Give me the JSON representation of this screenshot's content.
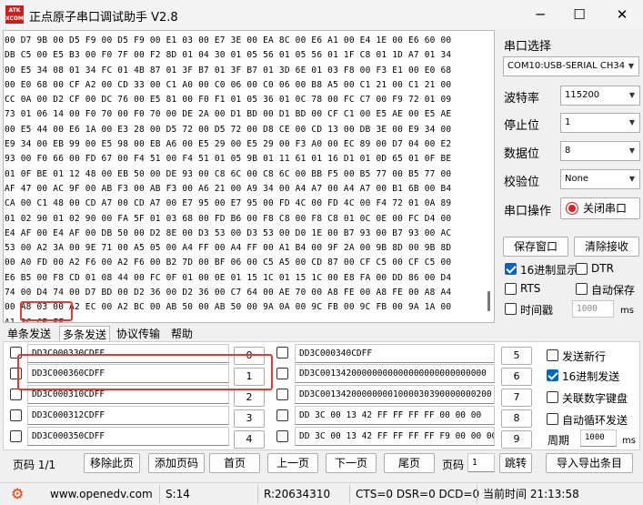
{
  "window": {
    "logo_top": "ATK",
    "logo_bottom": "XCOM",
    "title": "正点原子串口调试助手 V2.8",
    "minimize": "─",
    "maximize": "☐",
    "close": "✕"
  },
  "receive": {
    "lines": [
      "00 D7 9B 00 D5 F9 00 D5 F9 00 E1 03 00 E7 3E 00 EA 8C 00 E6 A1 00 E4 1E 00 E6 60 00",
      "DB C5 00 E5 B3 00 F0 7F 00 F2 8D 01 04 30 01 05 56 01 05 56 01 1F C8 01 1D A7 01 34",
      "00 E5 34 08 01 34 FC 01 4B 87 01 3F B7 01 3F B7 01 3D 6E 01 03 F8 00 F3 E1 00 E0 68",
      "00 E0 68 00 CF A2 00 CD 33 00 C1 A0 00 C0 06 00 C0 06 00 B8 A5 00 C1 21 00 C1 21 00",
      "CC 0A 00 D2 CF 00 DC 76 00 E5 81 00 F0 F1 01 05 36 01 0C 78 00 FC C7 00 F9 72 01 09",
      "73 01 06 14 00 F0 70 00 F0 70 00 DE 2A 00 D1 BD 00 D1 BD 00 CF C1 00 E5 AE 00 E5 AE",
      "00 E5 44 00 E6 1A 00 E3 28 00 D5 72 00 D5 72 00 D8 CE 00 CD 13 00 DB 3E 00 E9 34 00",
      "E9 34 00 EB 99 00 E5 98 00 EB A6 00 E5 29 00 E5 29 00 F3 A0 00 EC 89 00 D7 04 00 E2",
      "93 00 F0 66 00 FD 67 00 F4 51 00 F4 51 01 05 9B 01 11 61 01 16 D1 01 0D 65 01 0F BE",
      "01 0F BE 01 12 48 00 EB 50 00 DE 93 00 C8 6C 00 C8 6C 00 BB F5 00 B5 77 00 B5 77 00",
      "AF 47 00 AC 9F 00 AB F3 00 AB F3 00 A6 21 00 A9 34 00 A4 A7 00 A4 A7 00 B1 6B 00 B4",
      "CA 00 C1 48 00 CD A7 00 CD A7 00 E7 95 00 E7 95 00 FD 4C 00 FD 4C 00 F4 72 01 0A 89",
      "01 02 90 01 02 90 00 FA 5F 01 03 68 00 FD B6 00 F8 C8 00 F8 C8 01 0C 0E 00 FC D4 00",
      "E4 AF 00 E4 AF 00 DB 50 00 D2 8E 00 D3 53 00 D3 53 00 D0 1E 00 B7 93 00 B7 93 00 AC",
      "53 00 A2 3A 00 9E 71 00 A5 05 00 A4 FF 00 A4 FF 00 A1 B4 00 9F 2A 00 9B 8D 00 9B 8D",
      "00 A0 FD 00 A2 F6 00 A2 F6 00 B2 7D 00 BF 06 00 C5 A5 00 CD 87 00 CF C5 00 CF C5 00",
      "E6 B5 00 F8 CD 01 08 44 00 FC 0F 01 00 0E 01 15 1C 01 15 1C 00 E8 FA 00 DD 86 00 D4",
      "74 00 D4 74 00 D7 BD 00 D2 36 00 D2 36 00 C7 64 00 AE 70 00 A8 FE 00 A8 FE 00 A8 A4",
      "00 A8 03 00 A2 EC 00 A2 BC 00 AB 50 00 AB 50 00 9A 0A 00 9C FB 00 9C FB 00 9A 1A 00",
      "A1 3C CE FF"
    ]
  },
  "right": {
    "port_label": "串口选择",
    "port_value": "COM10:USB-SERIAL CH34",
    "baud_label": "波特率",
    "baud_value": "115200",
    "stop_label": "停止位",
    "stop_value": "1",
    "data_label": "数据位",
    "data_value": "8",
    "parity_label": "校验位",
    "parity_value": "None",
    "op_label": "串口操作",
    "close_port": "关闭串口",
    "save_window": "保存窗口",
    "clear_recv": "清除接收",
    "hex_display": "16进制显示",
    "dtr": "DTR",
    "rts": "RTS",
    "auto_save": "自动保存",
    "timestamp": "时间戳",
    "ms_value": "1000",
    "ms_unit": "ms"
  },
  "tabs": [
    "单条发送",
    "多条发送",
    "协议传输",
    "帮助"
  ],
  "multi": {
    "left": [
      {
        "value": "DD3C000330CDFF",
        "num": "0"
      },
      {
        "value": "DD3C000360CDFF",
        "num": "1"
      },
      {
        "value": "DD3C000310CDFF",
        "num": "2"
      },
      {
        "value": "DD3C000312CDFF",
        "num": "3"
      },
      {
        "value": "DD3C000350CDFF",
        "num": "4"
      }
    ],
    "right": [
      {
        "value": "DD3C000340CDFF",
        "num": "5"
      },
      {
        "value": "DD3C00134200000000000000000000000000",
        "num": "6"
      },
      {
        "value": "DD3C001342000000001000030390000000200",
        "num": "7"
      },
      {
        "value": "DD 3C 00 13 42 FF FF FF FF 00 00 00",
        "num": "8"
      },
      {
        "value": "DD 3C 00 13 42 FF FF FF FF F9 00 00 00",
        "num": "9"
      }
    ],
    "send_newline": "发送新行",
    "hex_send": "16进制发送",
    "link_keypad": "关联数字键盘",
    "auto_loop": "自动循环发送",
    "period_label": "周期",
    "period_value": "1000",
    "period_unit": "ms"
  },
  "bottom": {
    "page_label": "页码 1/1",
    "remove_page": "移除此页",
    "add_page": "添加页码",
    "first": "首页",
    "prev": "上一页",
    "next": "下一页",
    "last": "尾页",
    "page_num_label": "页码",
    "page_num_value": "1",
    "jump": "跳转",
    "import_export": "导入导出条目"
  },
  "status": {
    "gear": "⚙",
    "url": "www.openedv.com",
    "send_count": "S:14",
    "recv_count": "R:20634310",
    "signals": "CTS=0 DSR=0 DCD=0",
    "time": "当前时间 21:13:58"
  }
}
